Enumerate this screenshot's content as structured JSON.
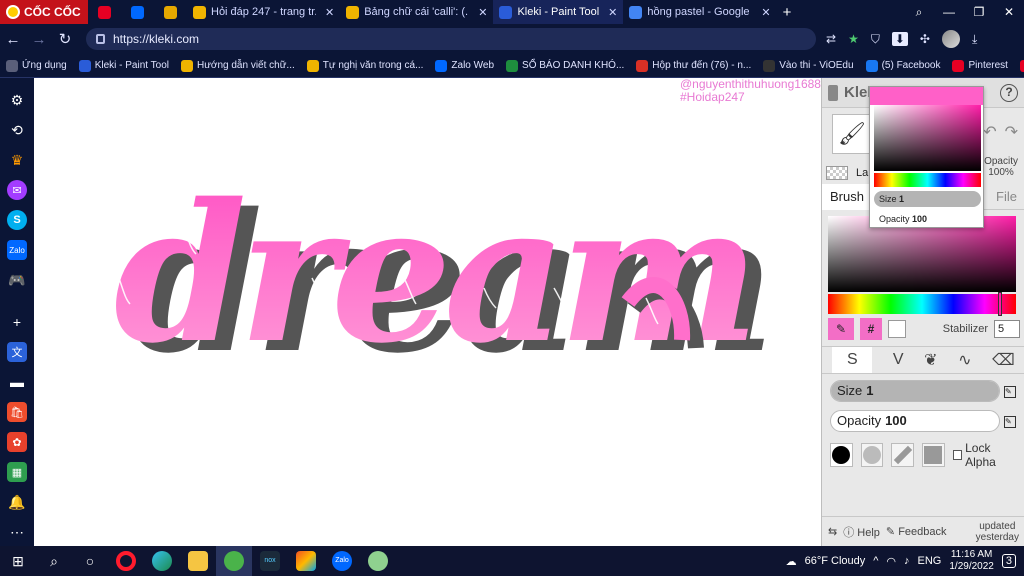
{
  "browser": {
    "brand": "CỐC CỐC",
    "tabs": [
      {
        "label": "",
        "color": "#e60023",
        "icon": "pinterest-icon"
      },
      {
        "label": "",
        "color": "#0068ff",
        "icon": "zalo-icon"
      },
      {
        "label": "",
        "color": "#e6a800",
        "icon": "d-icon"
      },
      {
        "label": "Hỏi đáp 247 - trang tr...",
        "color": "#f0b400",
        "icon": "hoidap-icon"
      },
      {
        "label": "Bảng chữ cái 'calli': (...",
        "color": "#f0b400",
        "icon": "hoidap-icon"
      },
      {
        "label": "Kleki - Paint Tool",
        "color": "#2a5cd8",
        "icon": "kleki-icon",
        "active": true
      },
      {
        "label": "hồng pastel - Google ...",
        "color": "#4285f4",
        "icon": "google-icon"
      }
    ],
    "url": "https://kleki.com",
    "bookmarks": [
      {
        "label": "Ứng dụng",
        "color": "#5a5f7a"
      },
      {
        "label": "Kleki - Paint Tool",
        "color": "#2a5cd8"
      },
      {
        "label": "Hướng dẫn viết chữ...",
        "color": "#f0b400"
      },
      {
        "label": "Tự nghị văn trong cá...",
        "color": "#f0b400"
      },
      {
        "label": "Zalo Web",
        "color": "#0068ff"
      },
      {
        "label": "SỔ BÁO DANH KHÓ...",
        "color": "#1e8e3e"
      },
      {
        "label": "Hộp thư đến (76) - n...",
        "color": "#d93025"
      },
      {
        "label": "Vào thi - ViOEdu",
        "color": "#333333"
      },
      {
        "label": "(5) Facebook",
        "color": "#1877f2"
      },
      {
        "label": "Pinterest",
        "color": "#e60023"
      },
      {
        "label": "Pinterest",
        "color": "#e60023"
      }
    ]
  },
  "canvas": {
    "watermark_line1": "@nguyenthithuhuong16880",
    "watermark_line2": "#Hoidap247",
    "lettering": "dream",
    "colors": {
      "fill": "#ff5cc8",
      "shadow": "#555555",
      "highlight": "#ffffff"
    }
  },
  "panel": {
    "logo": "Kleki",
    "help": "?",
    "layer_label": "La",
    "opacity_label": "Opacity",
    "opacity_value": "100%",
    "tab_brush": "Brush",
    "tab_file": "File",
    "stabilizer_label": "Stabilizer",
    "stabilizer_value": "5",
    "size_label": "Size",
    "size_value": "1",
    "opacity_slider_label": "Opacity",
    "opacity_slider_value": "100",
    "lock_alpha": "Lock Alpha",
    "help_label": "Help",
    "feedback_label": "Feedback",
    "updated_label": "updated",
    "updated_value": "yesterday",
    "primary_color": "#ff1ea8"
  },
  "popup": {
    "size_label": "Size",
    "size_value": "1",
    "opacity_label": "Opacity",
    "opacity_value": "100"
  },
  "taskbar": {
    "weather": "66°F  Cloudy",
    "lang": "ENG",
    "time": "11:16 AM",
    "date": "1/29/2022",
    "notifications": "3"
  }
}
